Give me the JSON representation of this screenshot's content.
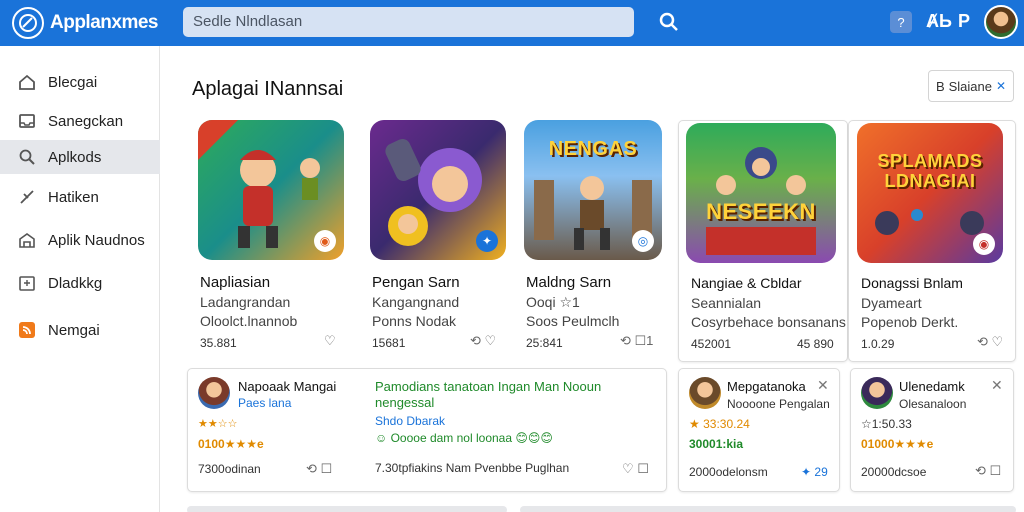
{
  "header": {
    "brand": "Applanxmes",
    "search_placeholder": "Sedle Nlndlasan",
    "icon_box_label": "?",
    "icon_t1": "ȺЬ",
    "icon_t2": "Р"
  },
  "sidebar": {
    "items": [
      {
        "label": "Blecgai",
        "icon": "home-icon"
      },
      {
        "label": "Sanegckan",
        "icon": "inbox-icon"
      },
      {
        "label": "Aplkods",
        "icon": "search-icon",
        "active": true
      },
      {
        "label": "Hatiken",
        "icon": "feather-icon"
      },
      {
        "label": "Aplik Naudnos",
        "icon": "building-icon"
      },
      {
        "label": "Dladkkg",
        "icon": "calendar-icon"
      },
      {
        "label": "Nemgai",
        "icon": "rss-icon"
      }
    ]
  },
  "main": {
    "title": "Aplagai INannsai",
    "sort_label": "Slaiane",
    "sort_prefix": "B",
    "apps": [
      {
        "name": "Napliasian",
        "sub1": "Ladangrandan",
        "sub2": "Oloolct.lnannob",
        "count": "35.881",
        "thumb_text": ""
      },
      {
        "name": "Pengan Sarn",
        "sub1": "Kangangnand",
        "sub2": "Ponns Nodak",
        "count": "15681",
        "thumb_text": ""
      },
      {
        "name": "Maldng Sarn",
        "sub1": "Ooqi ☆1",
        "sub2": "Soos Peulmclh",
        "count": "25:841",
        "thumb_text": "NENGAS"
      },
      {
        "name": "Nangiae & Cbldar",
        "sub1": "Seannialan",
        "sub2": "Cosyrbehace bonsanans",
        "count": "452001",
        "count2": "45 890",
        "thumb_text": "NESEEKN"
      },
      {
        "name": "Donagssi Bnlam",
        "sub1": "Dyameart",
        "sub2": "Popenob Derkt.",
        "count": "1.0.29",
        "thumb_text": "SPLAMADS LDNAGIAI"
      }
    ],
    "reviews": [
      {
        "name": "Napoaak Mangai",
        "sub": "Paes lana",
        "stars": "★★☆☆",
        "score": "0100★★★e",
        "foot": "7300odinan"
      },
      {
        "name": "Pamodians tanatoan Ingan Man Nooun nengessal",
        "sub": "Shdo Dbarak",
        "emoji": "☺ Ooooe dam nol loonaa 😊😊😊",
        "foot": "7.30tpfiakins Nam Pvenbbe Puglhan"
      },
      {
        "name": "Mepgatanoka",
        "sub": "Noooone Pengalan",
        "stars": "★ 33:30.24",
        "score": "30001:kia",
        "foot": "2000odelonsm",
        "foot2": "✦ 29"
      },
      {
        "name": "Ulenedamk",
        "sub": "Olesanaloon",
        "stars": "☆1:50.33",
        "score": "01000★★★e",
        "foot": "20000dcsoe"
      }
    ]
  },
  "colors": {
    "brand": "#1a73d9",
    "star": "#e08a00",
    "link": "#1a73d9",
    "green_text": "#1f8a2a"
  }
}
